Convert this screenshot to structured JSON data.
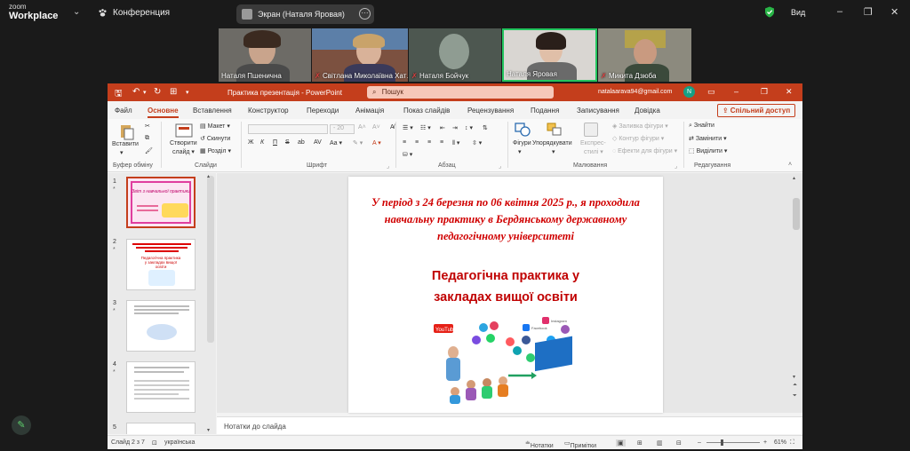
{
  "zoom": {
    "logo_top": "zoom",
    "logo_bottom": "Workplace",
    "meeting_label": "Конференция",
    "screen_share_label": "Экран (Наталя Яровая)",
    "view_label": "Вид",
    "accent": "#2d8cff",
    "shield_color": "#28b446"
  },
  "participants": [
    {
      "name": "Наталя Пшенична",
      "muted": false,
      "active": false
    },
    {
      "name": "Світлана Миколаївна Хат…",
      "muted": true,
      "active": false
    },
    {
      "name": "Наталя Бойчук",
      "muted": true,
      "active": false
    },
    {
      "name": "Наталя Яровая",
      "muted": false,
      "active": true
    },
    {
      "name": "Микита Дзюба",
      "muted": true,
      "active": false
    }
  ],
  "ppt": {
    "title": "Практика презентація  -  PowerPoint",
    "search_placeholder": "Пошук",
    "account": "natalaarava94@gmail.com",
    "avatar_letter": "N",
    "brand_color": "#c43e1c",
    "tabs": [
      "Файл",
      "Основне",
      "Вставлення",
      "Конструктор",
      "Переходи",
      "Анімація",
      "Показ слайдів",
      "Рецензування",
      "Подання",
      "Записування",
      "Довідка"
    ],
    "active_tab": "Основне",
    "share_label": "Спільний доступ",
    "ribbon": {
      "paste": "Вставити",
      "clipboard": "Буфер обміну",
      "new_slide_1": "Створити",
      "new_slide_2": "слайд",
      "layout": "Макет",
      "reset": "Скинути",
      "sections": "Розділ",
      "slides": "Слайди",
      "font_size": "20",
      "font": "Шрифт",
      "paragraph": "Абзац",
      "shapes": "Фігури",
      "arrange": "Упорядкувати",
      "quick_styles_1": "Експрес-",
      "quick_styles_2": "стилі",
      "fill": "Заливка фігури",
      "outline": "Контур фігури",
      "effects": "Ефекти для фігури",
      "drawing": "Малювання",
      "find": "Знайти",
      "replace": "Замінити",
      "select": "Виділити",
      "editing": "Редагування",
      "bold": "Ж",
      "italic": "К",
      "underline": "П",
      "strike": "S"
    },
    "thumbnails": [
      {
        "num": "1",
        "title": "Звіт з навчальної практики"
      },
      {
        "num": "2",
        "title": "Педагогічна практика у закладах вищої освіти"
      },
      {
        "num": "3",
        "title": ""
      },
      {
        "num": "4",
        "title": ""
      },
      {
        "num": "5",
        "title": ""
      }
    ],
    "slide": {
      "line1": "У період з  24 березня по 06 квітня 2025 р., я проходила",
      "line2": "навчальну практику в Бердянському державному",
      "line3": "педагогічному університеті",
      "heading1": "Педагогічна практика у",
      "heading2": "закладах вищої освіти",
      "yt_label": "YouTube",
      "ig_label": "Instagram",
      "fb_label": "Facebook"
    },
    "notes_placeholder": "Нотатки до слайда",
    "status": {
      "slide_of": "Слайд 2 з 7",
      "language": "українська",
      "notes": "Нотатки",
      "comments": "Примітки",
      "zoom": "61%"
    }
  }
}
